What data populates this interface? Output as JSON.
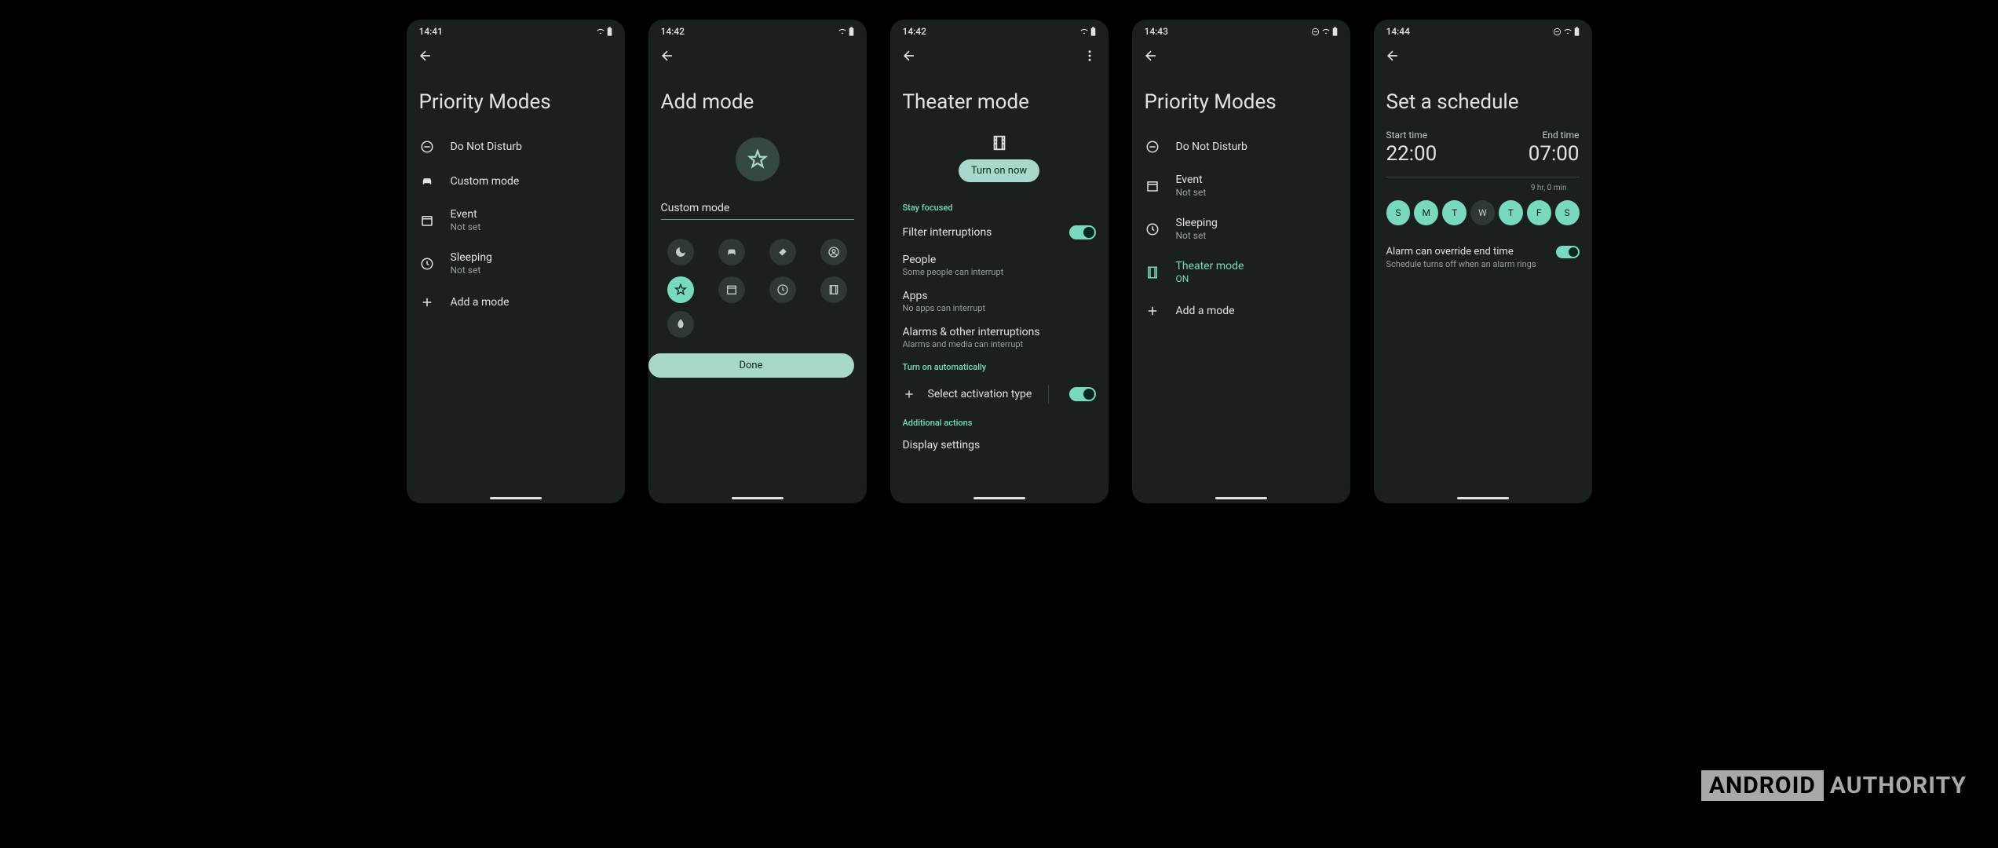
{
  "watermark": {
    "boxed": "ANDROID",
    "plain": "AUTHORITY"
  },
  "s1": {
    "time": "14:41",
    "title": "Priority Modes",
    "items": [
      {
        "name": "dnd",
        "primary": "Do Not Disturb",
        "secondary": ""
      },
      {
        "name": "custom",
        "primary": "Custom mode",
        "secondary": ""
      },
      {
        "name": "event",
        "primary": "Event",
        "secondary": "Not set"
      },
      {
        "name": "sleep",
        "primary": "Sleeping",
        "secondary": "Not set"
      },
      {
        "name": "add",
        "primary": "Add a mode",
        "secondary": ""
      }
    ]
  },
  "s2": {
    "time": "14:42",
    "title": "Add mode",
    "input_value": "Custom mode",
    "done": "Done"
  },
  "s3": {
    "time": "14:42",
    "title": "Theater mode",
    "turn_on": "Turn on now",
    "sec1": "Stay focused",
    "filter": "Filter interruptions",
    "people": {
      "primary": "People",
      "secondary": "Some people can interrupt"
    },
    "apps": {
      "primary": "Apps",
      "secondary": "No apps can interrupt"
    },
    "alarms": {
      "primary": "Alarms & other interruptions",
      "secondary": "Alarms and media can interrupt"
    },
    "sec2": "Turn on automatically",
    "activation": "Select activation type",
    "sec3": "Additional actions",
    "display": "Display settings"
  },
  "s4": {
    "time": "14:43",
    "title": "Priority Modes",
    "items": [
      {
        "primary": "Do Not Disturb",
        "secondary": ""
      },
      {
        "primary": "Event",
        "secondary": "Not set"
      },
      {
        "primary": "Sleeping",
        "secondary": "Not set"
      },
      {
        "primary": "Theater mode",
        "secondary": "ON"
      },
      {
        "primary": "Add a mode",
        "secondary": ""
      }
    ]
  },
  "s5": {
    "time": "14:44",
    "title": "Set a schedule",
    "start_label": "Start time",
    "start_val": "22:00",
    "end_label": "End time",
    "end_val": "07:00",
    "duration": "9 hr, 0 min",
    "days": [
      "S",
      "M",
      "T",
      "W",
      "T",
      "F",
      "S"
    ],
    "alarm": {
      "primary": "Alarm can override end time",
      "secondary": "Schedule turns off when an alarm rings"
    }
  }
}
